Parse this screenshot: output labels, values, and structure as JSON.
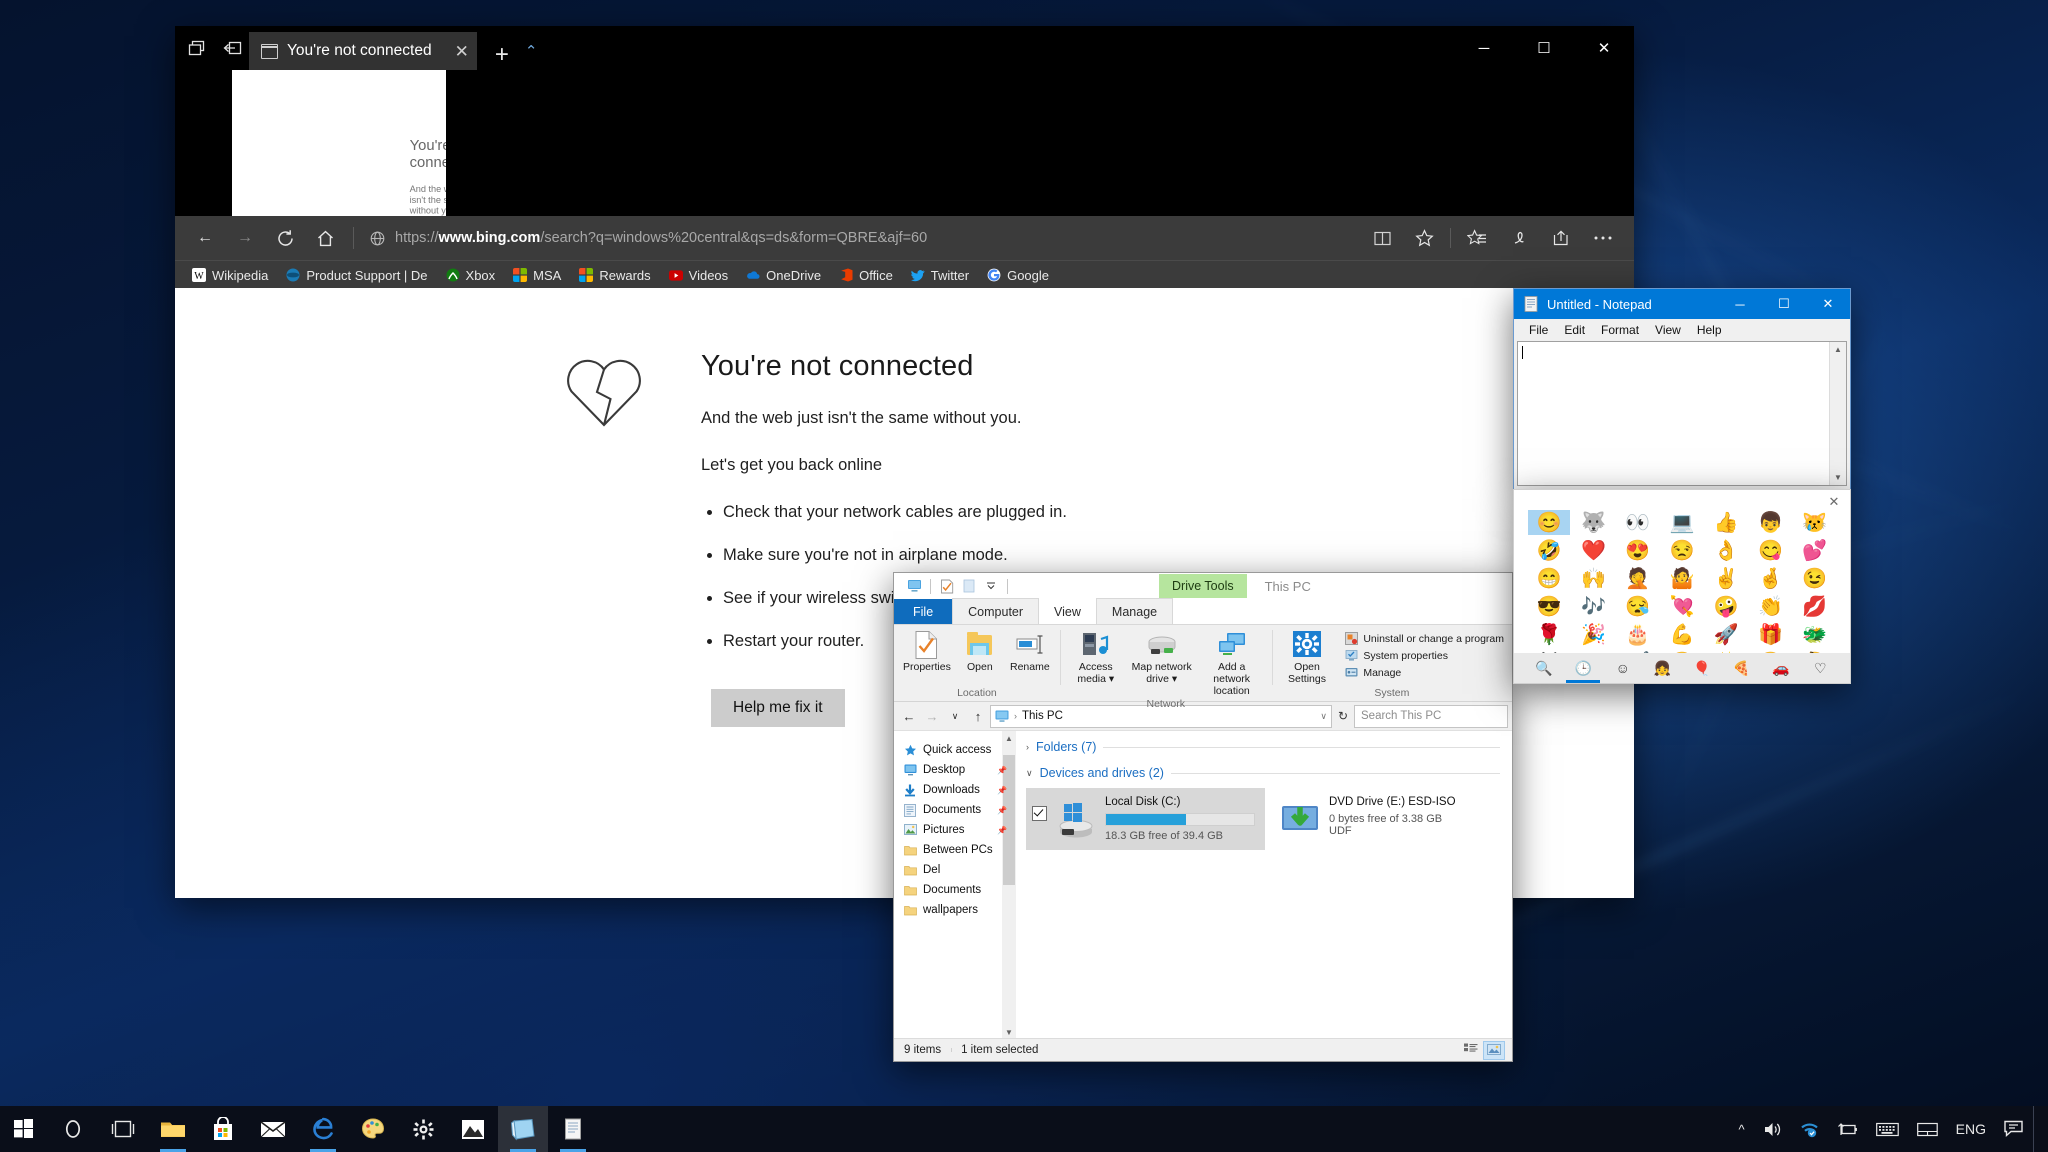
{
  "edge": {
    "tab": {
      "title": "You're not connected",
      "close_label": "✕",
      "favicon_name": "page-icon"
    },
    "titlebar_icons": [
      "tab-preview-icon",
      "set-aside-tabs-icon"
    ],
    "new_tab_label": "+",
    "tab_caret_label": "⌃",
    "window_controls": {
      "minimize": "─",
      "maximize": "☐",
      "close": "✕"
    },
    "nav": {
      "back": "←",
      "forward": "→",
      "refresh": "↻",
      "home": "⌂"
    },
    "url": {
      "scheme": "https://",
      "host": "www.bing.com",
      "path": "/search?q=windows%20central&qs=ds&form=QBRE&ajf=60",
      "full": "https://www.bing.com/search?q=windows%20central&qs=ds&form=QBRE&ajf=60"
    },
    "toolbar_right": [
      "reading-view-icon",
      "add-favorite-star-icon",
      "hub-favorites-icon",
      "web-notes-icon",
      "share-icon",
      "more-settings-icon"
    ],
    "favorites": [
      {
        "label": "Wikipedia",
        "icon": "wikipedia-icon",
        "color": "#ffffff"
      },
      {
        "label": "Product Support | De",
        "icon": "product-support-icon",
        "color": "#1a7bb5"
      },
      {
        "label": "Xbox",
        "icon": "xbox-icon",
        "color": "#107c10"
      },
      {
        "label": "MSA",
        "icon": "microsoft-icon",
        "color": "#f25022"
      },
      {
        "label": "Rewards",
        "icon": "microsoft-icon",
        "color": "#f25022"
      },
      {
        "label": "Videos",
        "icon": "youtube-icon",
        "color": "#cc0000"
      },
      {
        "label": "OneDrive",
        "icon": "onedrive-icon",
        "color": "#0f78d4"
      },
      {
        "label": "Office",
        "icon": "office-icon",
        "color": "#eb3c00"
      },
      {
        "label": "Twitter",
        "icon": "twitter-icon",
        "color": "#1da1f2"
      },
      {
        "label": "Google",
        "icon": "google-icon",
        "color": "#4285f4"
      }
    ],
    "page": {
      "heading": "You're not connected",
      "subtitle": "And the web just isn't the same without you.",
      "lead": "Let's get you back online",
      "tips": [
        "Check that your network cables are plugged in.",
        "Make sure you're not in airplane mode.",
        "See if your wireless switch is on.",
        "Restart your router."
      ],
      "button": "Help me fix it",
      "icon_name": "broken-heart-icon"
    }
  },
  "explorer": {
    "quick_access_toolbar": [
      "this-pc-icon",
      "properties-icon",
      "new-folder-icon",
      "customize-qat-chevron-icon"
    ],
    "context_tab_label": "Drive Tools",
    "window_title": "This PC",
    "tabs": [
      {
        "label": "File",
        "type": "file"
      },
      {
        "label": "Computer",
        "type": "active"
      },
      {
        "label": "View",
        "type": "normal"
      },
      {
        "label": "Manage",
        "type": "context"
      }
    ],
    "ribbon_groups": [
      {
        "label": "Location",
        "buttons": [
          {
            "label": "Properties",
            "icon": "properties-icon"
          },
          {
            "label": "Open",
            "icon": "open-folder-icon"
          },
          {
            "label": "Rename",
            "icon": "rename-icon"
          }
        ]
      },
      {
        "label": "Network",
        "buttons": [
          {
            "label": "Access media ▾",
            "icon": "access-media-icon"
          },
          {
            "label": "Map network drive ▾",
            "icon": "map-network-drive-icon"
          },
          {
            "label": "Add a network location",
            "icon": "add-network-location-icon"
          }
        ]
      },
      {
        "label": "System",
        "buttons": [
          {
            "label": "Open Settings",
            "icon": "settings-gear-icon"
          }
        ],
        "small_items": [
          {
            "label": "Uninstall or change a program",
            "icon": "uninstall-program-icon"
          },
          {
            "label": "System properties",
            "icon": "system-properties-icon"
          },
          {
            "label": "Manage",
            "icon": "computer-manage-icon"
          }
        ]
      }
    ],
    "address": {
      "crumb": "This PC",
      "icon": "this-pc-icon",
      "dropdown": "∨",
      "refresh": "↻"
    },
    "search_placeholder": "Search This PC",
    "nav_buttons": {
      "back": "←",
      "forward": "→",
      "recent": "∨",
      "up": "↑"
    },
    "tree": [
      {
        "label": "Quick access",
        "icon": "star-icon",
        "pinned": false
      },
      {
        "label": "Desktop",
        "icon": "desktop-icon",
        "pinned": true
      },
      {
        "label": "Downloads",
        "icon": "downloads-icon",
        "pinned": true
      },
      {
        "label": "Documents",
        "icon": "documents-icon",
        "pinned": true
      },
      {
        "label": "Pictures",
        "icon": "pictures-icon",
        "pinned": true
      },
      {
        "label": "Between PCs",
        "icon": "folder-icon",
        "pinned": false
      },
      {
        "label": "Del",
        "icon": "folder-icon",
        "pinned": false
      },
      {
        "label": "Documents",
        "icon": "folder-icon",
        "pinned": false
      },
      {
        "label": "wallpapers",
        "icon": "folder-icon",
        "pinned": false
      }
    ],
    "groups": [
      {
        "label": "Folders (7)",
        "expanded": false,
        "chev": "›"
      },
      {
        "label": "Devices and drives (2)",
        "expanded": true,
        "chev": "∨"
      }
    ],
    "drives": [
      {
        "name": "Local Disk (C:)",
        "free_text": "18.3 GB free of 39.4 GB",
        "used_percent": 54,
        "selected": true,
        "checked": true,
        "icon": "windows-drive-icon",
        "extra": ""
      },
      {
        "name": "DVD Drive (E:) ESD-ISO",
        "free_text": "0 bytes free of 3.38 GB",
        "used_percent": 100,
        "selected": false,
        "checked": false,
        "icon": "dvd-drive-icon",
        "extra": "UDF"
      }
    ],
    "status": {
      "items_count": "9 items",
      "selection": "1 item selected"
    },
    "view_buttons": [
      "details-view-icon",
      "large-icons-view-icon"
    ]
  },
  "notepad": {
    "title": "Untitled - Notepad",
    "icon_name": "notepad-icon",
    "menu": [
      "File",
      "Edit",
      "Format",
      "View",
      "Help"
    ],
    "window_controls": {
      "minimize": "─",
      "maximize": "☐",
      "close": "✕"
    },
    "content": ""
  },
  "emoji_panel": {
    "close_label": "✕",
    "selected_index": 0,
    "emojis": [
      "😊",
      "🐺",
      "👀",
      "💻",
      "👍",
      "👦",
      "😿",
      "🤣",
      "❤️",
      "😍",
      "😒",
      "👌",
      "😋",
      "💕",
      "😁",
      "🙌",
      "🤦",
      "🤷",
      "✌️",
      "🤞",
      "😉",
      "😎",
      "🎶",
      "😪",
      "💘",
      "🤪",
      "👏",
      "💋",
      "🌹",
      "🎉",
      "🎂",
      "💪",
      "🚀",
      "🎁",
      "🐲",
      "🦊",
      "🎮",
      "✔️",
      "😃",
      "✨",
      "😆",
      "🤔"
    ],
    "category_tabs": [
      {
        "icon": "search-icon",
        "glyph": "🔍",
        "active": false
      },
      {
        "icon": "recent-clock-icon",
        "glyph": "🕒",
        "active": true
      },
      {
        "icon": "smileys-icon",
        "glyph": "☺",
        "active": false
      },
      {
        "icon": "people-icon",
        "glyph": "👧",
        "active": false
      },
      {
        "icon": "celebration-icon",
        "glyph": "🎈",
        "active": false
      },
      {
        "icon": "food-icon",
        "glyph": "🍕",
        "active": false
      },
      {
        "icon": "transport-icon",
        "glyph": "🚗",
        "active": false
      },
      {
        "icon": "symbols-heart-icon",
        "glyph": "♡",
        "active": false
      }
    ]
  },
  "taskbar": {
    "start_label": "start-button",
    "apps": [
      {
        "name": "cortana-search",
        "icon": "circle-icon",
        "running": false,
        "active": false
      },
      {
        "name": "task-view",
        "icon": "task-view-icon",
        "running": false,
        "active": false
      },
      {
        "name": "file-explorer",
        "icon": "folder-icon",
        "running": true,
        "active": false
      },
      {
        "name": "microsoft-store",
        "icon": "store-icon",
        "running": false,
        "active": false
      },
      {
        "name": "mail",
        "icon": "mail-icon",
        "running": false,
        "active": false
      },
      {
        "name": "microsoft-edge",
        "icon": "edge-icon",
        "running": true,
        "active": false
      },
      {
        "name": "paint",
        "icon": "paint-palette-icon",
        "running": false,
        "active": false
      },
      {
        "name": "settings",
        "icon": "gear-icon",
        "running": false,
        "active": false
      },
      {
        "name": "photos",
        "icon": "photos-icon",
        "running": false,
        "active": false
      },
      {
        "name": "file-explorer-window",
        "icon": "explorer-window-icon",
        "running": true,
        "active": true
      },
      {
        "name": "notepad",
        "icon": "notepad-icon",
        "running": true,
        "active": false
      }
    ],
    "tray": [
      {
        "name": "show-hidden-icons",
        "glyph": "⌃"
      },
      {
        "name": "volume-icon",
        "glyph": "🔊"
      },
      {
        "name": "network-icon",
        "glyph": "network"
      },
      {
        "name": "battery-icon",
        "glyph": "battery"
      },
      {
        "name": "touch-keyboard-icon",
        "glyph": "keyboard"
      },
      {
        "name": "touchpad-icon",
        "glyph": "touchpad"
      },
      {
        "name": "language-indicator",
        "glyph": "ENG"
      },
      {
        "name": "action-center-icon",
        "glyph": "notification"
      }
    ]
  }
}
